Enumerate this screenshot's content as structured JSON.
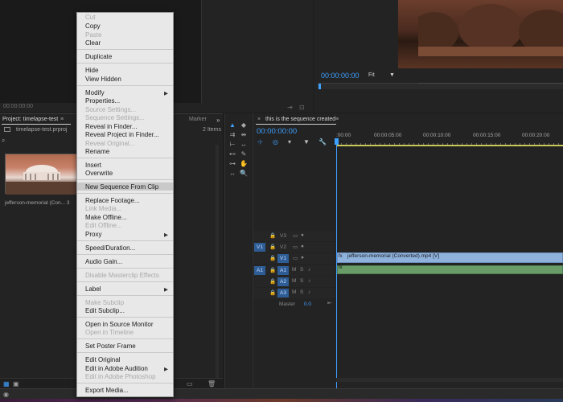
{
  "source_monitor": {
    "timecode": "00:00:00:00"
  },
  "program_monitor": {
    "timecode": "00:00:00:00",
    "zoom": "Fit",
    "zoom_arrow": "▼",
    "btn_export": "⇥",
    "btn_settings": "⊡"
  },
  "project_panel": {
    "tab_label": "Project: timelapse-test",
    "tab_menu": "≡",
    "marker_tab": "Marker",
    "more_icon": "»",
    "file_name": "timelapse-test.prproj",
    "items_count": "2 Items",
    "search_icon": "⌕",
    "clip_label": "jefferson-memorial (Con...  3",
    "footer_list_icon": "▦",
    "footer_icon_view": "▣",
    "footer_new": "▭",
    "footer_trash": "🗑"
  },
  "timeline": {
    "close_icon": "×",
    "sequence_name": "this is the sequence created",
    "menu_icon": "≡",
    "timecode": "00:00:00:00",
    "ruler_labels": [
      ":00:00",
      "00:00:05:00",
      "00:00:10:00",
      "00:00:15:00",
      "00:00:20:00"
    ],
    "video_tracks": [
      {
        "source": "",
        "name": "V3"
      },
      {
        "source": "V1",
        "name": "V2"
      },
      {
        "source": "",
        "name": "V1"
      }
    ],
    "audio_tracks": [
      {
        "source": "A1",
        "name": "A1",
        "m": "M",
        "s": "S"
      },
      {
        "source": "",
        "name": "A2",
        "m": "M",
        "s": "S"
      },
      {
        "source": "",
        "name": "A3",
        "m": "M",
        "s": "S"
      }
    ],
    "clip_v1_label": "jefferson-memorial (Converted).mp4 [V]",
    "master_label": "Master",
    "master_value": "0.0"
  },
  "context_menu": {
    "items": [
      {
        "label": "Cut",
        "disabled": true
      },
      {
        "label": "Copy",
        "disabled": false
      },
      {
        "label": "Paste",
        "disabled": true
      },
      {
        "label": "Clear",
        "disabled": false
      },
      {
        "label": "Duplicate",
        "disabled": false
      },
      {
        "label": "Hide",
        "disabled": false
      },
      {
        "label": "View Hidden",
        "disabled": false
      },
      {
        "label": "Modify",
        "disabled": false,
        "submenu": true
      },
      {
        "label": "Properties...",
        "disabled": false
      },
      {
        "label": "Source Settings...",
        "disabled": true
      },
      {
        "label": "Sequence Settings...",
        "disabled": true
      },
      {
        "label": "Reveal in Finder...",
        "disabled": false
      },
      {
        "label": "Reveal Project in Finder...",
        "disabled": false
      },
      {
        "label": "Reveal Original...",
        "disabled": true
      },
      {
        "label": "Rename",
        "disabled": false
      },
      {
        "label": "Insert",
        "disabled": false
      },
      {
        "label": "Overwrite",
        "disabled": false
      },
      {
        "label": "New Sequence From Clip",
        "disabled": false,
        "highlighted": true
      },
      {
        "label": "Replace Footage...",
        "disabled": false
      },
      {
        "label": "Link Media...",
        "disabled": true
      },
      {
        "label": "Make Offline...",
        "disabled": false
      },
      {
        "label": "Edit Offline...",
        "disabled": true
      },
      {
        "label": "Proxy",
        "disabled": false,
        "submenu": true
      },
      {
        "label": "Speed/Duration...",
        "disabled": false
      },
      {
        "label": "Audio Gain...",
        "disabled": false
      },
      {
        "label": "Disable Masterclip Effects",
        "disabled": true
      },
      {
        "label": "Label",
        "disabled": false,
        "submenu": true
      },
      {
        "label": "Make Subclip",
        "disabled": true
      },
      {
        "label": "Edit Subclip...",
        "disabled": false
      },
      {
        "label": "Open in Source Monitor",
        "disabled": false
      },
      {
        "label": "Open in Timeline",
        "disabled": true
      },
      {
        "label": "Set Poster Frame",
        "disabled": false
      },
      {
        "label": "Edit Original",
        "disabled": false
      },
      {
        "label": "Edit in Adobe Audition",
        "disabled": false,
        "submenu": true
      },
      {
        "label": "Edit in Adobe Photoshop",
        "disabled": true
      },
      {
        "label": "Export Media...",
        "disabled": false
      }
    ],
    "submenu_arrow": "▶"
  },
  "tools": {
    "selection": "▲",
    "track_select": "⇉",
    "ripple": "⊢",
    "rolling": "⇹",
    "rate": "↔",
    "razor": "◆",
    "slip": "⊷",
    "slide": "⊶",
    "pen": "✎",
    "hand": "✋",
    "zoom": "🔍"
  },
  "timeline_tools": {
    "snap": "⊹",
    "linked": "◎",
    "add_marker": "▾",
    "markers": "▼",
    "settings": "🔧"
  },
  "icons": {
    "lock": "🔒",
    "eye": "👁",
    "film": "▭",
    "mic": "🎤",
    "master_end": "⇤"
  }
}
